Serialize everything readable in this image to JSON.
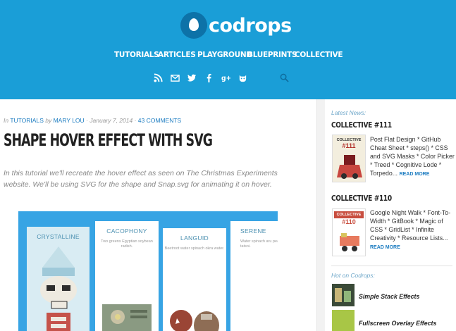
{
  "brand": {
    "logo_text": "codrops"
  },
  "nav": {
    "items": [
      "TUTORIALS",
      "ARTICLES",
      "PLAYGROUND",
      "BLUEPRINTS",
      "COLLECTIVE"
    ]
  },
  "social": [
    "rss-icon",
    "mail-icon",
    "twitter-icon",
    "facebook-icon",
    "google-plus-icon",
    "github-icon",
    "search-icon"
  ],
  "article": {
    "meta_in": "In",
    "category": "TUTORIALS",
    "meta_by": "by",
    "author": "MARY LOU",
    "date": "· January 7, 2014 ·",
    "comments": "43 COMMENTS",
    "title": "SHAPE HOVER EFFECT WITH SVG",
    "excerpt": "In this tutorial we'll recreate the hover effect as seen on The Christmas Experiments website. We'll be using SVG for the shape and Snap.svg for animating it on hover."
  },
  "demo": {
    "cards": [
      {
        "title": "CRYSTALLINE",
        "sub": ""
      },
      {
        "title": "CACOPHONY",
        "sub": "Two greens Egyptian soybean radish."
      },
      {
        "title": "LANGUID",
        "sub": "Beetroot water spinach okra water."
      },
      {
        "title": "SERENE",
        "sub": "Water spinach aru pea tatsoi."
      }
    ]
  },
  "sidebar": {
    "latest_label": "Latest News:",
    "news": [
      {
        "title": "COLLECTIVE #111",
        "thumb_label": "COLLECTIVE",
        "thumb_num": "#111",
        "text": "Post Flat Design * GitHub Cheat Sheet * steps() * CSS and SVG Masks * Color Picker * Treed * Cognitive Lode * Torpedo...",
        "read_more": "READ MORE"
      },
      {
        "title": "COLLECTIVE #110",
        "thumb_label": "COLLECTIVE",
        "thumb_num": "#110",
        "text": "Google Night Walk * Font-To-Width * GitBook * Magic of CSS * GridList * Infinite Creativity * Resource Lists...",
        "read_more": "READ MORE"
      }
    ],
    "hot_label": "Hot on Codrops:",
    "hot": [
      {
        "title": "Simple Stack Effects"
      },
      {
        "title": "Fullscreen Overlay Effects"
      }
    ]
  },
  "colors": {
    "header_bg": "#1a9ed7",
    "link": "#1a7bc0",
    "demo_bg": "#37a4e4"
  }
}
